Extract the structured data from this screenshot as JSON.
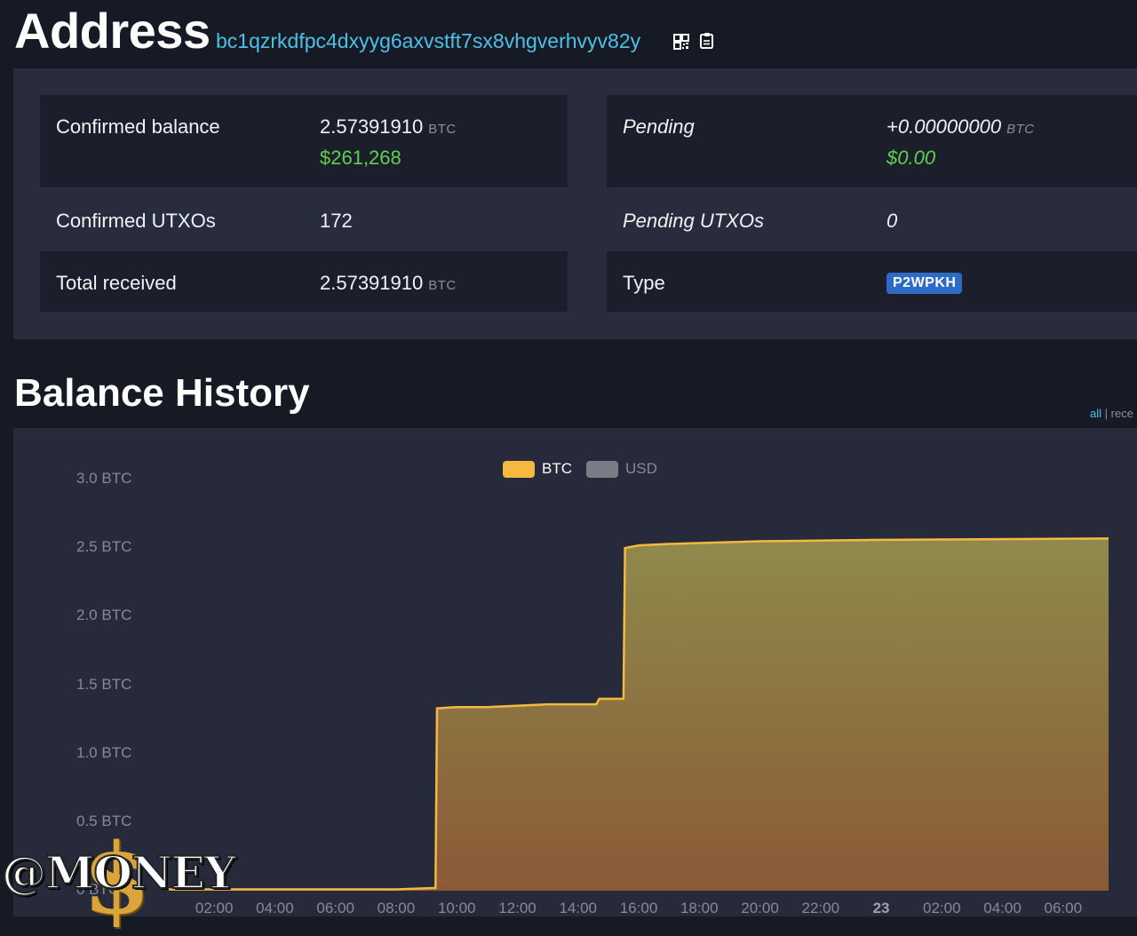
{
  "header": {
    "title": "Address",
    "address": "bc1qzrkdfpc4dxyyg6axvstft7sx8vhgverhvyv82y",
    "qr_icon": "qr-code-icon",
    "copy_icon": "clipboard-icon"
  },
  "summary": {
    "confirmed_balance": {
      "label": "Confirmed balance",
      "value": "2.57391910",
      "unit": "BTC",
      "fiat": "$261,268"
    },
    "pending": {
      "label": "Pending",
      "value": "+0.00000000",
      "unit": "BTC",
      "fiat": "$0.00"
    },
    "confirmed_utxos": {
      "label": "Confirmed UTXOs",
      "value": "172"
    },
    "pending_utxos": {
      "label": "Pending UTXOs",
      "value": "0"
    },
    "total_received": {
      "label": "Total received",
      "value": "2.57391910",
      "unit": "BTC"
    },
    "type": {
      "label": "Type",
      "value": "P2WPKH"
    }
  },
  "balance_history": {
    "title": "Balance History",
    "range_all": "all",
    "range_sep": "|",
    "range_recent": "rece"
  },
  "colors": {
    "btc_series": "#f5b942",
    "usd_series": "#7a7d86",
    "fiat_green": "#5fcf4e",
    "link": "#4ec0e8",
    "badge": "#2e6bc7"
  },
  "chart_data": {
    "type": "area",
    "legend": [
      {
        "name": "BTC",
        "active": true
      },
      {
        "name": "USD",
        "active": false
      }
    ],
    "yticks": [
      "3.0 BTC",
      "2.5 BTC",
      "2.0 BTC",
      "1.5 BTC",
      "1.0 BTC",
      "0.5 BTC",
      "0 BTC"
    ],
    "ylim": [
      0,
      3.0
    ],
    "xticks": [
      {
        "label": "02:00",
        "bold": false
      },
      {
        "label": "04:00",
        "bold": false
      },
      {
        "label": "06:00",
        "bold": false
      },
      {
        "label": "08:00",
        "bold": false
      },
      {
        "label": "10:00",
        "bold": false
      },
      {
        "label": "12:00",
        "bold": false
      },
      {
        "label": "14:00",
        "bold": false
      },
      {
        "label": "16:00",
        "bold": false
      },
      {
        "label": "18:00",
        "bold": false
      },
      {
        "label": "20:00",
        "bold": false
      },
      {
        "label": "22:00",
        "bold": false
      },
      {
        "label": "23",
        "bold": true
      },
      {
        "label": "02:00",
        "bold": false
      },
      {
        "label": "04:00",
        "bold": false
      },
      {
        "label": "06:00",
        "bold": false
      }
    ],
    "x_unit": "hours",
    "xlim": [
      0.5,
      31.5
    ],
    "series": [
      {
        "name": "BTC",
        "points": [
          [
            0.5,
            0.01
          ],
          [
            8.0,
            0.01
          ],
          [
            9.3,
            0.02
          ],
          [
            9.35,
            1.33
          ],
          [
            10.0,
            1.34
          ],
          [
            11.0,
            1.34
          ],
          [
            13.0,
            1.36
          ],
          [
            14.6,
            1.36
          ],
          [
            14.7,
            1.4
          ],
          [
            15.5,
            1.4
          ],
          [
            15.55,
            2.5
          ],
          [
            16.0,
            2.52
          ],
          [
            17.0,
            2.53
          ],
          [
            20.0,
            2.55
          ],
          [
            24.0,
            2.56
          ],
          [
            31.5,
            2.57
          ]
        ]
      }
    ]
  },
  "watermark": {
    "text": "@MONEY",
    "symbol": "$"
  }
}
